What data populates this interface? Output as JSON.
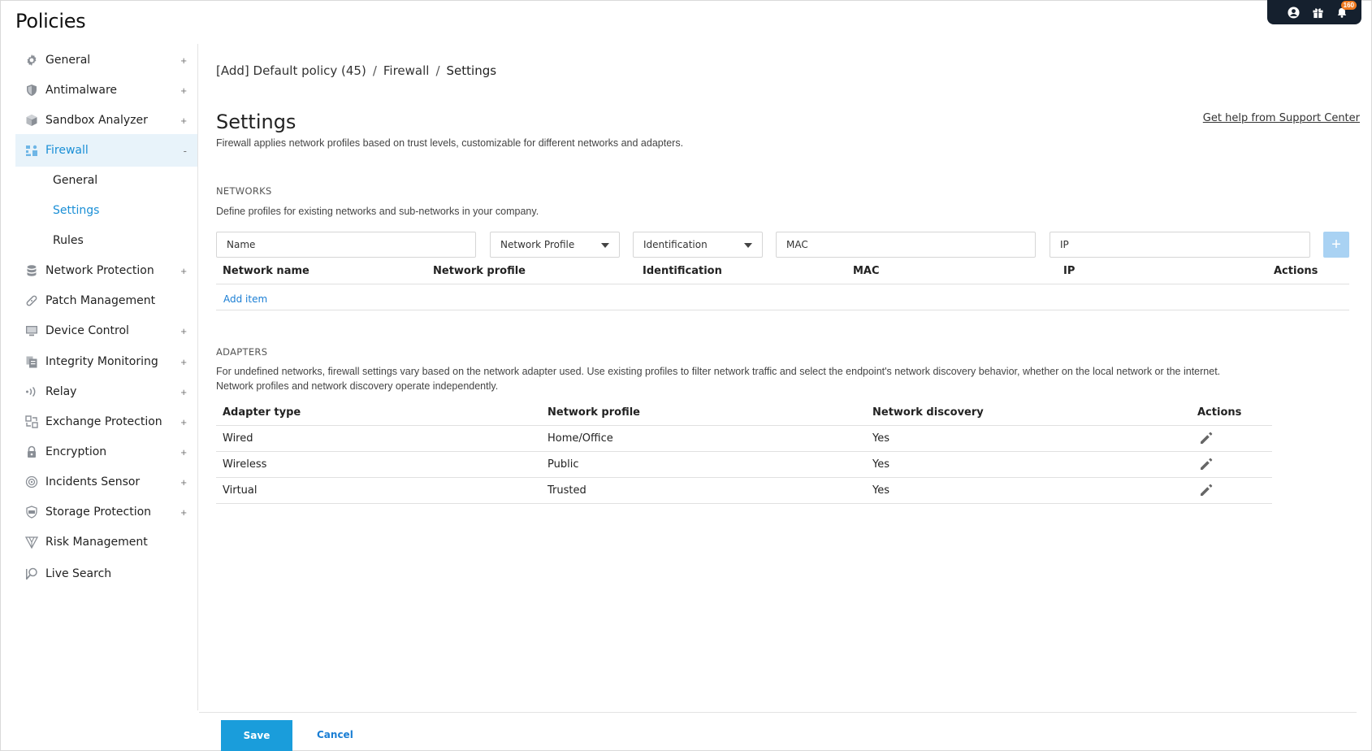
{
  "page": {
    "title": "Policies"
  },
  "topbar": {
    "notification_count": "160"
  },
  "sidebar": {
    "items": [
      {
        "label": "General",
        "icon": "gear-icon",
        "toggle": "+"
      },
      {
        "label": "Antimalware",
        "icon": "shield-icon",
        "toggle": "+"
      },
      {
        "label": "Sandbox Analyzer",
        "icon": "cube-icon",
        "toggle": "+"
      },
      {
        "label": "Firewall",
        "icon": "firewall-icon",
        "toggle": "-"
      },
      {
        "label": "Network Protection",
        "icon": "database-icon",
        "toggle": "+"
      },
      {
        "label": "Patch Management",
        "icon": "bandage-icon",
        "toggle": ""
      },
      {
        "label": "Device Control",
        "icon": "monitor-icon",
        "toggle": "+"
      },
      {
        "label": "Integrity Monitoring",
        "icon": "files-icon",
        "toggle": "+"
      },
      {
        "label": "Relay",
        "icon": "relay-icon",
        "toggle": "+"
      },
      {
        "label": "Exchange Protection",
        "icon": "exchange-icon",
        "toggle": "+"
      },
      {
        "label": "Encryption",
        "icon": "lock-icon",
        "toggle": "+"
      },
      {
        "label": "Incidents Sensor",
        "icon": "sensor-icon",
        "toggle": "+"
      },
      {
        "label": "Storage Protection",
        "icon": "storage-icon",
        "toggle": "+"
      },
      {
        "label": "Risk Management",
        "icon": "risk-icon",
        "toggle": ""
      },
      {
        "label": "Live Search",
        "icon": "live-search-icon",
        "toggle": ""
      }
    ],
    "firewall_sub": [
      {
        "label": "General"
      },
      {
        "label": "Settings"
      },
      {
        "label": "Rules"
      }
    ]
  },
  "breadcrumb": {
    "policy": "[Add] Default policy (45)",
    "section": "Firewall",
    "current": "Settings",
    "separator": "/"
  },
  "header": {
    "title": "Settings",
    "help_link": "Get help from Support Center",
    "description": "Firewall applies network profiles based on trust levels, customizable for different networks and adapters."
  },
  "networks": {
    "title": "NETWORKS",
    "description": "Define profiles for existing networks and sub-networks in your company.",
    "filters": {
      "name_placeholder": "Name",
      "profile_selected": "Network Profile",
      "identification_selected": "Identification",
      "mac_placeholder": "MAC",
      "ip_placeholder": "IP"
    },
    "columns": [
      "Network name",
      "Network profile",
      "Identification",
      "MAC",
      "IP",
      "Actions"
    ],
    "add_item": "Add item"
  },
  "adapters": {
    "title": "ADAPTERS",
    "description_line1": "For undefined networks, firewall settings vary based on the network adapter used. Use existing profiles to filter network traffic and select the endpoint's network discovery behavior, whether on the local network or the internet.",
    "description_line2": "Network profiles and network discovery operate independently.",
    "columns": [
      "Adapter type",
      "Network profile",
      "Network discovery",
      "Actions"
    ],
    "rows": [
      {
        "type": "Wired",
        "profile": "Home/Office",
        "discovery": "Yes"
      },
      {
        "type": "Wireless",
        "profile": "Public",
        "discovery": "Yes"
      },
      {
        "type": "Virtual",
        "profile": "Trusted",
        "discovery": "Yes"
      }
    ]
  },
  "footer": {
    "save": "Save",
    "cancel": "Cancel"
  },
  "colors": {
    "accent": "#1a9ddb",
    "link": "#1a7ed4",
    "active_bg": "#e8f3fa",
    "topbar": "#15202e",
    "badge": "#f07a20"
  }
}
